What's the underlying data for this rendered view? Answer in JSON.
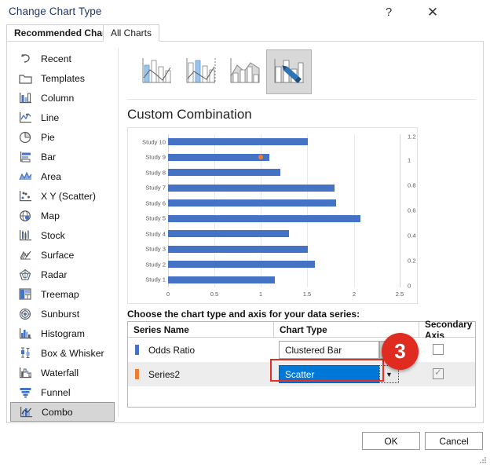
{
  "dialog": {
    "title": "Change Chart Type",
    "help_icon": "question-mark-icon",
    "close_icon": "close-icon"
  },
  "tabs": [
    {
      "label": "Recommended Charts",
      "selected": false
    },
    {
      "label": "All Charts",
      "selected": true
    }
  ],
  "chart_types": [
    {
      "label": "Recent",
      "icon": "recent-undo-icon",
      "selected": false
    },
    {
      "label": "Templates",
      "icon": "folder-icon",
      "selected": false
    },
    {
      "label": "Column",
      "icon": "column-chart-icon",
      "selected": false
    },
    {
      "label": "Line",
      "icon": "line-chart-icon",
      "selected": false
    },
    {
      "label": "Pie",
      "icon": "pie-chart-icon",
      "selected": false
    },
    {
      "label": "Bar",
      "icon": "bar-chart-icon",
      "selected": false
    },
    {
      "label": "Area",
      "icon": "area-chart-icon",
      "selected": false
    },
    {
      "label": "X Y (Scatter)",
      "icon": "scatter-chart-icon",
      "selected": false
    },
    {
      "label": "Map",
      "icon": "map-globe-icon",
      "selected": false
    },
    {
      "label": "Stock",
      "icon": "stock-chart-icon",
      "selected": false
    },
    {
      "label": "Surface",
      "icon": "surface-chart-icon",
      "selected": false
    },
    {
      "label": "Radar",
      "icon": "radar-chart-icon",
      "selected": false
    },
    {
      "label": "Treemap",
      "icon": "treemap-icon",
      "selected": false
    },
    {
      "label": "Sunburst",
      "icon": "sunburst-icon",
      "selected": false
    },
    {
      "label": "Histogram",
      "icon": "histogram-icon",
      "selected": false
    },
    {
      "label": "Box & Whisker",
      "icon": "box-whisker-icon",
      "selected": false
    },
    {
      "label": "Waterfall",
      "icon": "waterfall-icon",
      "selected": false
    },
    {
      "label": "Funnel",
      "icon": "funnel-icon",
      "selected": false
    },
    {
      "label": "Combo",
      "icon": "combo-chart-icon",
      "selected": true
    }
  ],
  "gallery": [
    {
      "name": "clustered-column-line-thumb",
      "active": false
    },
    {
      "name": "clustered-column-line-secondary-axis-thumb",
      "active": false
    },
    {
      "name": "stacked-area-clustered-column-thumb",
      "active": false
    },
    {
      "name": "custom-combination-thumb",
      "active": true
    }
  ],
  "preview": {
    "heading": "Custom Combination"
  },
  "series_section": {
    "prompt": "Choose the chart type and axis for your data series:",
    "columns": [
      "Series Name",
      "Chart Type",
      "Secondary Axis"
    ],
    "rows": [
      {
        "name": "Odds Ratio",
        "swatch_color": "#4472c4",
        "chart_type": "Clustered Bar",
        "secondary_axis": false,
        "focused": false
      },
      {
        "name": "Series2",
        "swatch_color": "#ed7d31",
        "chart_type": "Scatter",
        "secondary_axis": true,
        "focused": true
      }
    ]
  },
  "annotation": {
    "badge_label": "3",
    "badge_color": "#e02b20",
    "highlight_color": "#ee2a24"
  },
  "footer": {
    "ok_label": "OK",
    "cancel_label": "Cancel"
  },
  "chart_data": {
    "type": "bar",
    "title": "Custom Combination",
    "orientation": "horizontal",
    "categories": [
      "Study 1",
      "Study 2",
      "Study 3",
      "Study 4",
      "Study 5",
      "Study 6",
      "Study 7",
      "Study 8",
      "Study 9",
      "Study 10"
    ],
    "series": [
      {
        "name": "Odds Ratio",
        "type": "bar",
        "color": "#4472c4",
        "values": [
          1.15,
          1.58,
          1.5,
          1.3,
          2.07,
          1.81,
          1.79,
          1.21,
          1.09,
          1.5
        ]
      },
      {
        "name": "Series2",
        "type": "scatter",
        "color": "#ed7d31",
        "points": [
          {
            "category": "Study 9",
            "x": 1.0,
            "y": 1.0
          }
        ]
      }
    ],
    "xlabel": "",
    "ylabel": "",
    "xlim": [
      0,
      2.5
    ],
    "xticks": [
      "0",
      "0.5",
      "1",
      "1.5",
      "2",
      "2.5"
    ],
    "secondary_axis": {
      "position": "right",
      "lim": [
        0,
        1.2
      ],
      "ticks": [
        "0",
        "0.2",
        "0.4",
        "0.6",
        "0.8",
        "1",
        "1.2"
      ]
    },
    "grid": true,
    "legend": "none"
  }
}
